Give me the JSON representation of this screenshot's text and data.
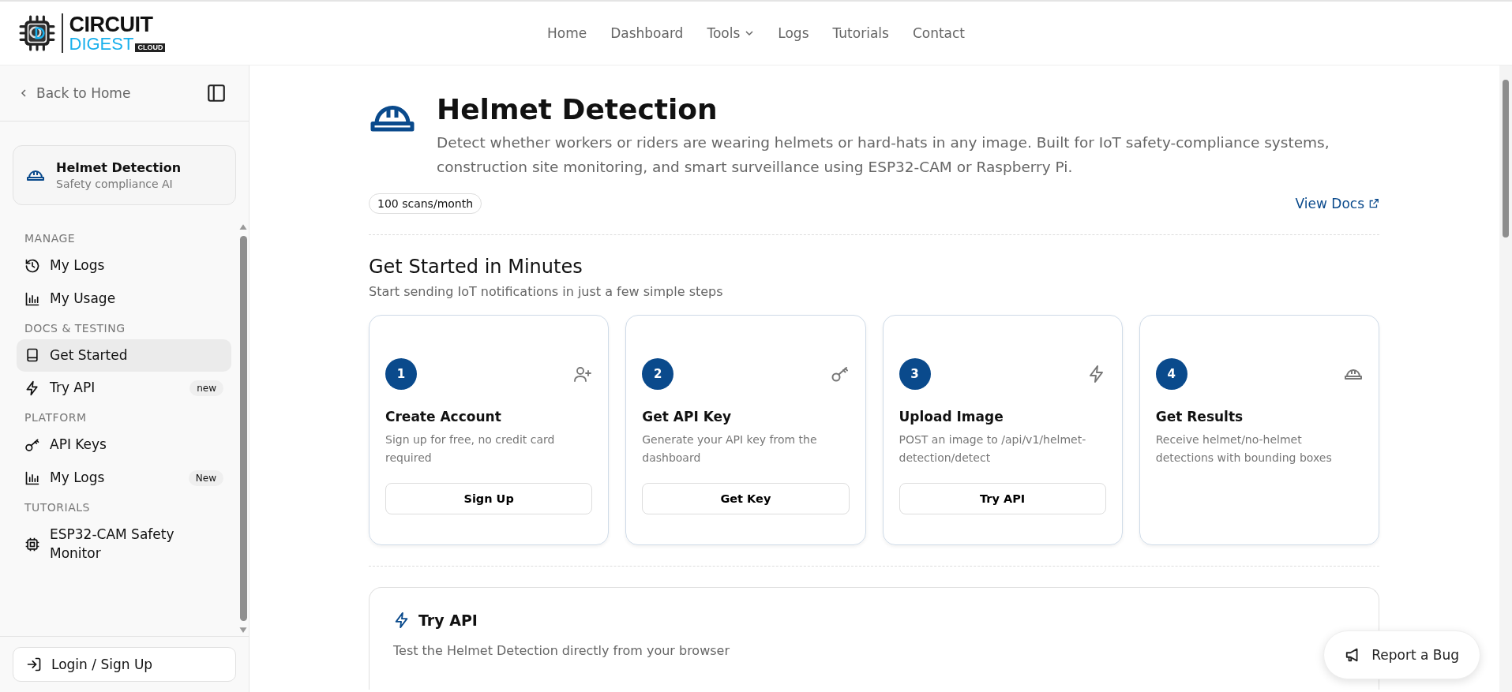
{
  "logo": {
    "line_1": "CIRCUIT",
    "line_2": "DIGEST",
    "tag": "CLOUD"
  },
  "nav": [
    {
      "label": "Home",
      "dropdown": false
    },
    {
      "label": "Dashboard",
      "dropdown": false
    },
    {
      "label": "Tools",
      "dropdown": true
    },
    {
      "label": "Logs",
      "dropdown": false
    },
    {
      "label": "Tutorials",
      "dropdown": false
    },
    {
      "label": "Contact",
      "dropdown": false
    }
  ],
  "sidebar": {
    "back": "Back to Home",
    "product": {
      "title": "Helmet Detection",
      "subtitle": "Safety compliance AI"
    },
    "sections": [
      {
        "heading": "MANAGE",
        "items": [
          {
            "label": "My Logs",
            "selected": false
          },
          {
            "label": "My Usage",
            "selected": false
          }
        ]
      },
      {
        "heading": "DOCS & TESTING",
        "items": [
          {
            "label": "Get Started",
            "selected": true
          },
          {
            "label": "Try API",
            "selected": false,
            "badge": "new"
          }
        ]
      },
      {
        "heading": "PLATFORM",
        "items": [
          {
            "label": "API Keys",
            "selected": false
          },
          {
            "label": "My Logs",
            "selected": false,
            "badge": "New"
          }
        ]
      },
      {
        "heading": "TUTORIALS",
        "items": [
          {
            "label": "ESP32-CAM Safety Monitor",
            "selected": false
          }
        ]
      }
    ],
    "login": "Login / Sign Up"
  },
  "page": {
    "title": "Helmet Detection",
    "description": "Detect whether workers or riders are wearing helmets or hard-hats in any image. Built for IoT safety-compliance systems, construction site monitoring, and smart surveillance using ESP32-CAM or Raspberry Pi.",
    "quota": "100 scans/month",
    "docs_link": "View Docs"
  },
  "get_started": {
    "title": "Get Started in Minutes",
    "subtitle": "Start sending IoT notifications in just a few simple steps",
    "steps": [
      {
        "number": "1",
        "title": "Create Account",
        "text": "Sign up for free, no credit card required",
        "button": "Sign Up"
      },
      {
        "number": "2",
        "title": "Get API Key",
        "text": "Generate your API key from the dashboard",
        "button": "Get Key"
      },
      {
        "number": "3",
        "title": "Upload Image",
        "text": "POST an image to /api/v1/helmet-detection/detect",
        "button": "Try API"
      },
      {
        "number": "4",
        "title": "Get Results",
        "text": "Receive helmet/no-helmet detections with bounding boxes"
      }
    ]
  },
  "try_api": {
    "title": "Try API",
    "subtitle": "Test the Helmet Detection directly from your browser"
  },
  "report_bug": "Report a Bug"
}
